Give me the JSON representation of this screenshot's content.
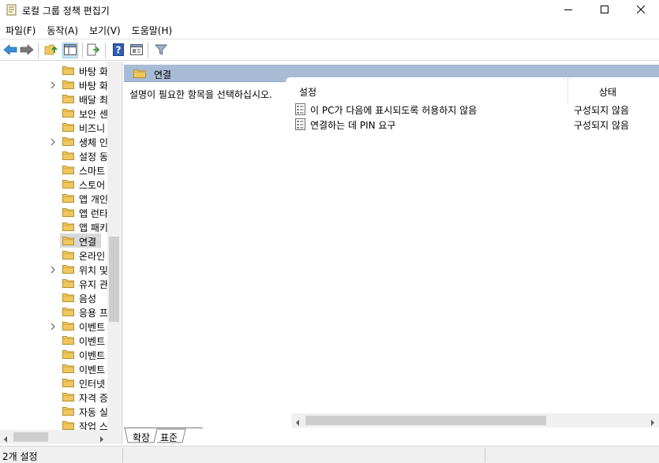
{
  "window": {
    "title": "로컬 그룹 정책 편집기",
    "icon": "policy-document-icon",
    "controls": [
      "minimize-icon",
      "maximize-icon",
      "close-icon"
    ]
  },
  "menu": [
    {
      "label": "파일(F)"
    },
    {
      "label": "동작(A)"
    },
    {
      "label": "보기(V)"
    },
    {
      "label": "도움말(H)"
    }
  ],
  "toolbar": {
    "buttons": [
      "back-arrow-icon",
      "forward-arrow-icon",
      "up-folder-icon",
      "show-hide-tree-icon",
      "export-list-icon",
      "help-icon",
      "properties-icon",
      "filter-icon"
    ]
  },
  "tree": {
    "items": [
      {
        "label": "바탕 화",
        "expandable": false
      },
      {
        "label": "바탕 화",
        "expandable": true
      },
      {
        "label": "배달 최",
        "expandable": false
      },
      {
        "label": "보안 센",
        "expandable": false
      },
      {
        "label": "비즈니",
        "expandable": false
      },
      {
        "label": "생체 인",
        "expandable": true
      },
      {
        "label": "설정 동",
        "expandable": false
      },
      {
        "label": "스마트",
        "expandable": false
      },
      {
        "label": "스토어",
        "expandable": false
      },
      {
        "label": "앱 개인",
        "expandable": false
      },
      {
        "label": "앱 런타",
        "expandable": false
      },
      {
        "label": "앱 패키",
        "expandable": false
      },
      {
        "label": "연결",
        "expandable": false,
        "selected": true
      },
      {
        "label": "온라인",
        "expandable": false
      },
      {
        "label": "위치 및",
        "expandable": true
      },
      {
        "label": "유지 관",
        "expandable": false
      },
      {
        "label": "음성",
        "expandable": false
      },
      {
        "label": "응용 프",
        "expandable": false
      },
      {
        "label": "이벤트",
        "expandable": true
      },
      {
        "label": "이벤트",
        "expandable": false
      },
      {
        "label": "이벤트",
        "expandable": false
      },
      {
        "label": "이벤트",
        "expandable": false
      },
      {
        "label": "인터넷",
        "expandable": false
      },
      {
        "label": "자격 증",
        "expandable": false
      },
      {
        "label": "자동 실",
        "expandable": false
      },
      {
        "label": "작업 스",
        "expandable": false
      }
    ]
  },
  "content": {
    "header_title": "연결",
    "description": "설명이 필요한 항목을 선택하십시오.",
    "columns": {
      "setting": "설정",
      "state": "상태"
    },
    "rows": [
      {
        "name": "이 PC가 다음에 표시되도록 허용하지 않음",
        "state": "구성되지 않음"
      },
      {
        "name": "연결하는 데 PIN 요구",
        "state": "구성되지 않음"
      }
    ],
    "tabs": [
      {
        "label": "확장",
        "active": true
      },
      {
        "label": "표준",
        "active": false
      }
    ]
  },
  "status": {
    "text": "2개 설정"
  },
  "colors": {
    "header_bar": "#a7bbd4",
    "folder": "#f0c75e",
    "selection": "#d9d9d9"
  }
}
